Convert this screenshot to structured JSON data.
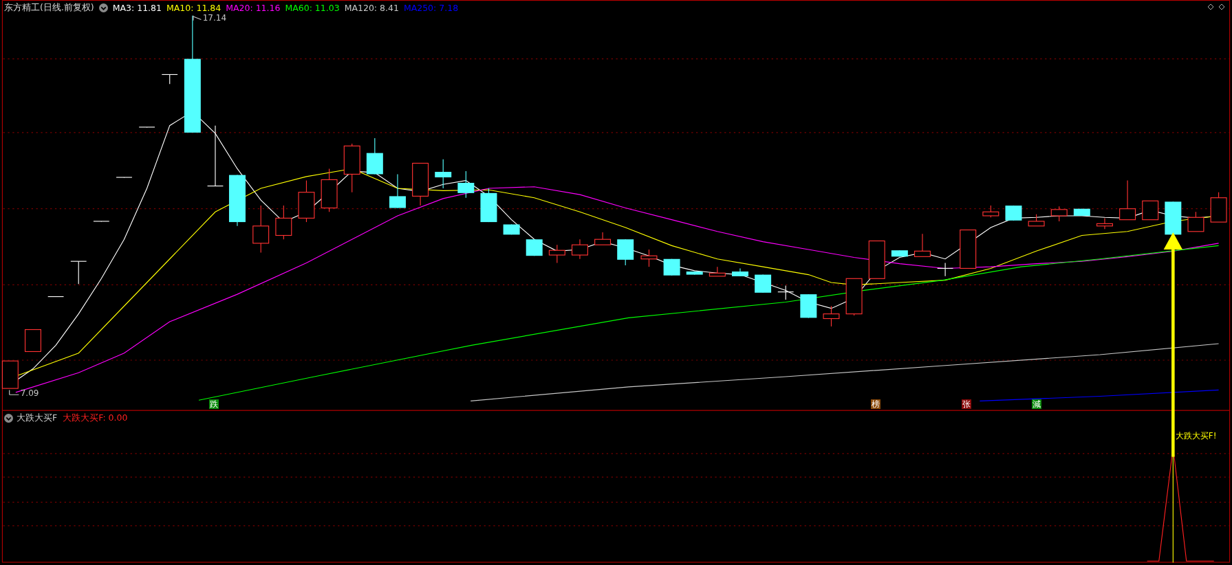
{
  "title": "东方精工(日线.前复权)",
  "ma_legend": [
    {
      "label": "MA3: 11.81",
      "color": "#ffffff"
    },
    {
      "label": "MA10: 11.84",
      "color": "#ffff00"
    },
    {
      "label": "MA20: 11.16",
      "color": "#ff00ff"
    },
    {
      "label": "MA60: 11.03",
      "color": "#00ff00"
    },
    {
      "label": "MA120: 8.41",
      "color": "#c8c8c8"
    },
    {
      "label": "MA250: 7.18",
      "color": "#0000ff"
    }
  ],
  "price_labels": {
    "high": "17.14",
    "low": "7.09"
  },
  "signal_marks": [
    {
      "text": "跌",
      "color": "#0a8a0a"
    },
    {
      "text": "榜",
      "color": "#8b4a0a"
    },
    {
      "text": "张",
      "color": "#8b0a0a"
    },
    {
      "text": "減",
      "color": "#0a8a0a"
    }
  ],
  "indicator": {
    "name": "大跌大买F",
    "value_label": "大跌大买F: 0.00",
    "signal_text": "大跌大买F!"
  }
}
